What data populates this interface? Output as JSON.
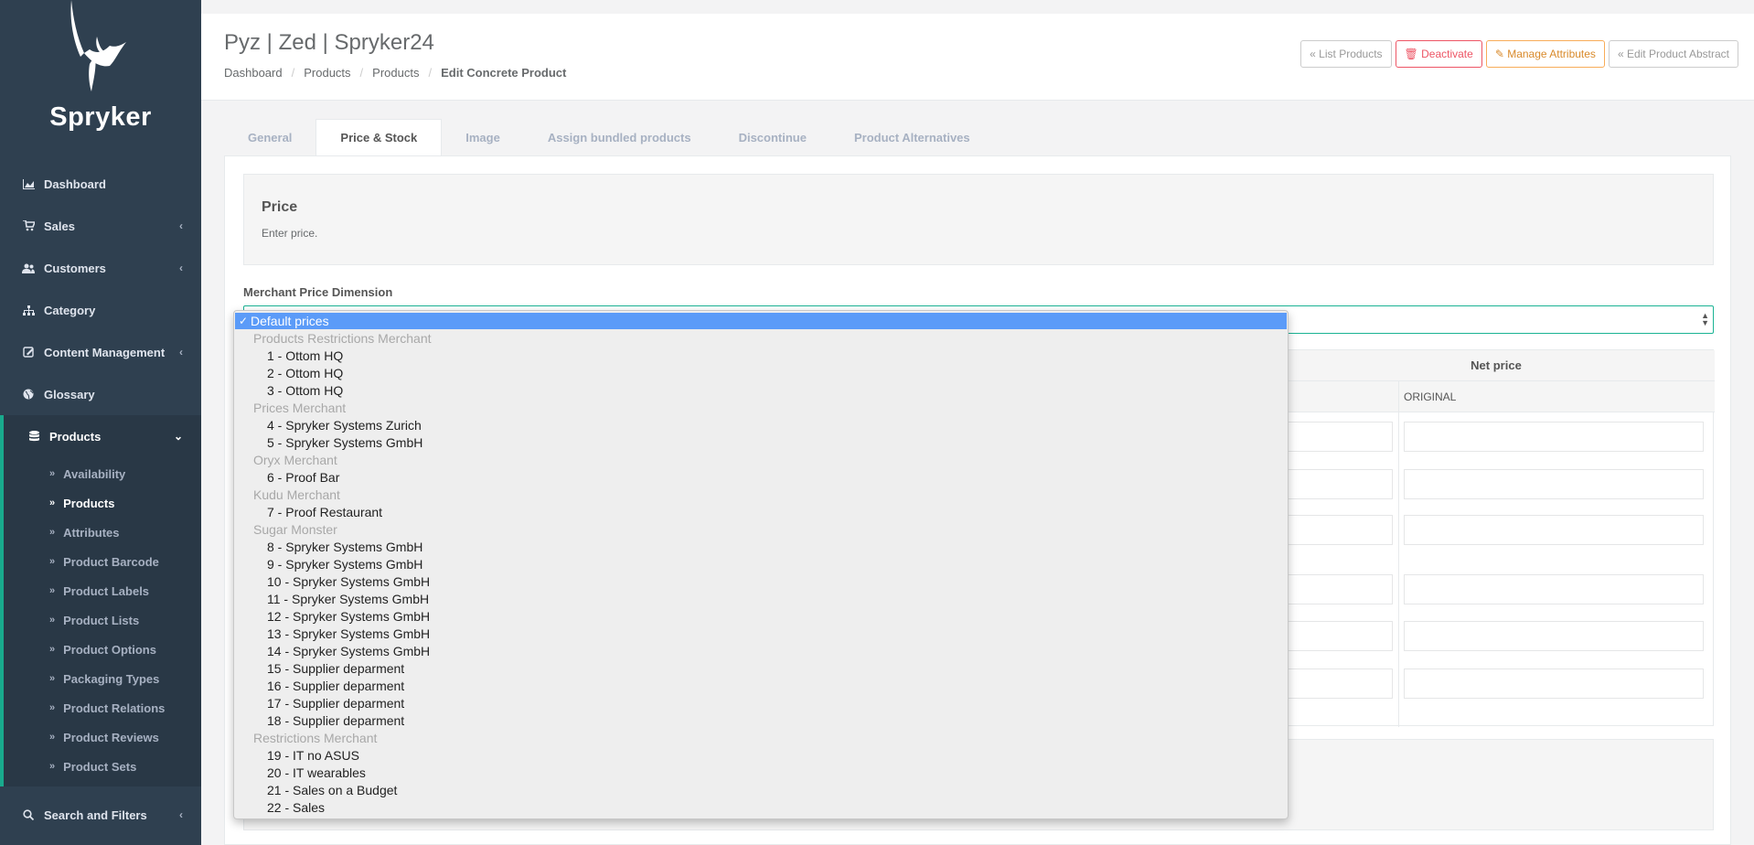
{
  "brand": {
    "name": "Spryker"
  },
  "sidebar": {
    "items": [
      {
        "label": "Dashboard",
        "icon": "area-chart-icon",
        "has_children": false
      },
      {
        "label": "Sales",
        "icon": "cart-icon",
        "has_children": true
      },
      {
        "label": "Customers",
        "icon": "users-icon",
        "has_children": true
      },
      {
        "label": "Category",
        "icon": "sitemap-icon",
        "has_children": false
      },
      {
        "label": "Content Management",
        "icon": "content-icon",
        "has_children": true
      },
      {
        "label": "Glossary",
        "icon": "globe-icon",
        "has_children": false
      },
      {
        "label": "Products",
        "icon": "database-icon",
        "has_children": true,
        "active": true
      }
    ],
    "products_sub": [
      "Availability",
      "Products",
      "Attributes",
      "Product Barcode",
      "Product Labels",
      "Product Lists",
      "Product Options",
      "Packaging Types",
      "Product Relations",
      "Product Reviews",
      "Product Sets"
    ],
    "current_sub": "Products",
    "bottom_item": {
      "label": "Search and Filters",
      "icon": "search-icon"
    }
  },
  "header": {
    "title": "Pyz | Zed | Spryker24",
    "breadcrumb": [
      "Dashboard",
      "Products",
      "Products",
      "Edit Concrete Product"
    ],
    "buttons": {
      "list_products": "« List Products",
      "deactivate": "🗑 Deactivate",
      "manage_attributes": "✎ Manage Attributes",
      "edit_abstract": "« Edit Product Abstract"
    }
  },
  "tabs": [
    "General",
    "Price & Stock",
    "Image",
    "Assign bundled products",
    "Discontinue",
    "Product Alternatives"
  ],
  "active_tab": "Price & Stock",
  "price_section": {
    "title": "Price",
    "description": "Enter price."
  },
  "merchant_field": {
    "label": "Merchant Price Dimension",
    "value": "Default prices"
  },
  "table": {
    "net_price_header": "Net price",
    "original_header": "ORIGINAL"
  },
  "dropdown": {
    "selected": "Default prices",
    "entries": [
      {
        "type": "group",
        "label": "Products Restrictions Merchant"
      },
      {
        "type": "option",
        "label": "1 - Ottom HQ"
      },
      {
        "type": "option",
        "label": "2 - Ottom HQ"
      },
      {
        "type": "option",
        "label": "3 - Ottom HQ"
      },
      {
        "type": "group",
        "label": "Prices Merchant"
      },
      {
        "type": "option",
        "label": "4 - Spryker Systems Zurich"
      },
      {
        "type": "option",
        "label": "5 - Spryker Systems GmbH"
      },
      {
        "type": "group",
        "label": "Oryx Merchant"
      },
      {
        "type": "option",
        "label": "6 - Proof Bar"
      },
      {
        "type": "group",
        "label": "Kudu Merchant"
      },
      {
        "type": "option",
        "label": "7 - Proof Restaurant"
      },
      {
        "type": "group",
        "label": "Sugar Monster"
      },
      {
        "type": "option",
        "label": "8 - Spryker Systems GmbH"
      },
      {
        "type": "option",
        "label": "9 - Spryker Systems GmbH"
      },
      {
        "type": "option",
        "label": "10 - Spryker Systems GmbH"
      },
      {
        "type": "option",
        "label": "11 - Spryker Systems GmbH"
      },
      {
        "type": "option",
        "label": "12 - Spryker Systems GmbH"
      },
      {
        "type": "option",
        "label": "13 - Spryker Systems GmbH"
      },
      {
        "type": "option",
        "label": "14 - Spryker Systems GmbH"
      },
      {
        "type": "option",
        "label": "15 - Supplier deparment"
      },
      {
        "type": "option",
        "label": "16 - Supplier deparment"
      },
      {
        "type": "option",
        "label": "17 - Supplier deparment"
      },
      {
        "type": "option",
        "label": "18 - Supplier deparment"
      },
      {
        "type": "group",
        "label": "Restrictions Merchant"
      },
      {
        "type": "option",
        "label": "19 - IT no ASUS"
      },
      {
        "type": "option",
        "label": "20 - IT wearables"
      },
      {
        "type": "option",
        "label": "21 - Sales on a Budget"
      },
      {
        "type": "option",
        "label": "22 - Sales"
      }
    ]
  },
  "colors": {
    "sidebar_bg": "#2f4050",
    "accent": "#19aa8d",
    "highlight": "#5b9bf8",
    "danger": "#ed5565",
    "warning": "#f8ac59"
  }
}
